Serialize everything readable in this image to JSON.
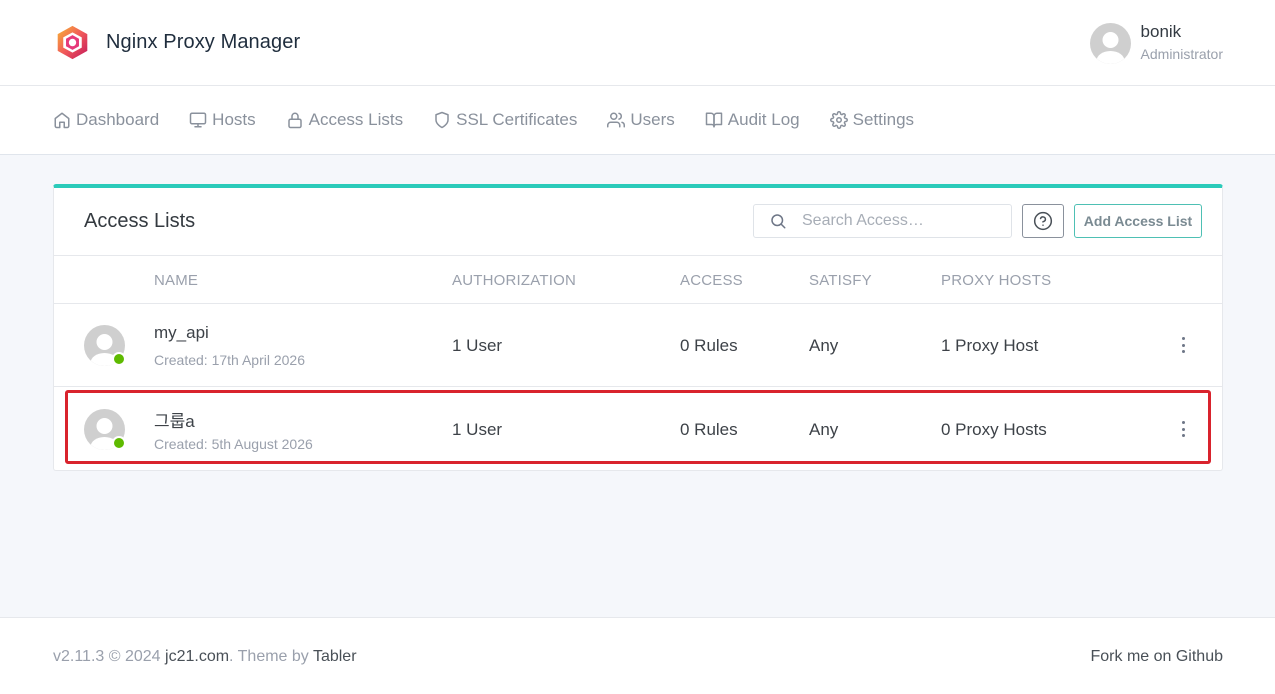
{
  "brand": {
    "name": "Nginx Proxy Manager"
  },
  "user": {
    "name": "bonik",
    "role": "Administrator"
  },
  "nav": {
    "items": [
      {
        "label": "Dashboard",
        "icon": "home-icon"
      },
      {
        "label": "Hosts",
        "icon": "monitor-icon"
      },
      {
        "label": "Access Lists",
        "icon": "lock-icon"
      },
      {
        "label": "SSL Certificates",
        "icon": "shield-icon"
      },
      {
        "label": "Users",
        "icon": "users-icon"
      },
      {
        "label": "Audit Log",
        "icon": "book-icon"
      },
      {
        "label": "Settings",
        "icon": "gear-icon"
      }
    ]
  },
  "card": {
    "title": "Access Lists",
    "search_placeholder": "Search Access…",
    "add_label": "Add Access List",
    "columns": [
      "NAME",
      "AUTHORIZATION",
      "ACCESS",
      "SATISFY",
      "PROXY HOSTS"
    ],
    "rows": [
      {
        "name": "my_api",
        "created": "Created: 17th April 2026",
        "authorization": "1 User",
        "access": "0 Rules",
        "satisfy": "Any",
        "proxy_hosts": "1 Proxy Host",
        "status": "online"
      },
      {
        "name": "그룹a",
        "created": "Created: 5th August 2026",
        "authorization": "1 User",
        "access": "0 Rules",
        "satisfy": "Any",
        "proxy_hosts": "0 Proxy Hosts",
        "status": "online"
      }
    ]
  },
  "footer": {
    "version": "v2.11.3 © 2024 ",
    "site_link": "jc21.com",
    "theme_text": ". Theme by ",
    "theme_link": "Tabler",
    "github_link": "Fork me on Github"
  },
  "colors": {
    "accent": "#2bcbba",
    "online": "#5eba00",
    "highlight": "#d9232d"
  }
}
